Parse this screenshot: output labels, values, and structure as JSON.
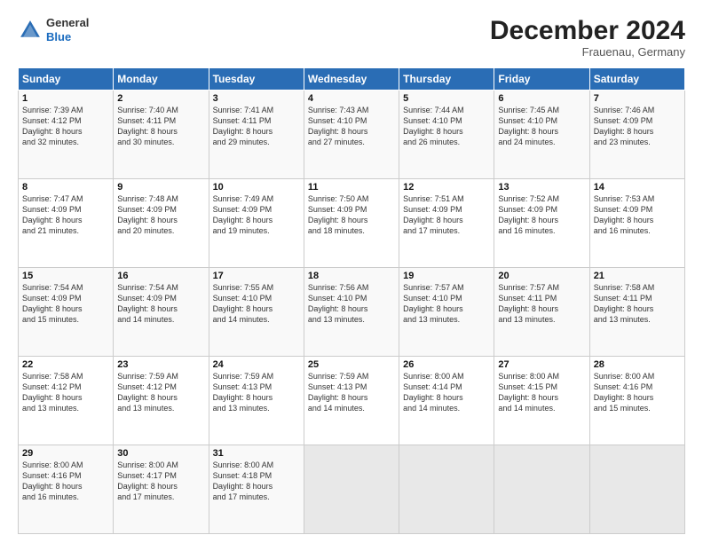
{
  "header": {
    "logo": {
      "general": "General",
      "blue": "Blue"
    },
    "month": "December 2024",
    "location": "Frauenau, Germany"
  },
  "weekdays": [
    "Sunday",
    "Monday",
    "Tuesday",
    "Wednesday",
    "Thursday",
    "Friday",
    "Saturday"
  ],
  "weeks": [
    [
      {
        "day": "1",
        "lines": [
          "Sunrise: 7:39 AM",
          "Sunset: 4:12 PM",
          "Daylight: 8 hours",
          "and 32 minutes."
        ]
      },
      {
        "day": "2",
        "lines": [
          "Sunrise: 7:40 AM",
          "Sunset: 4:11 PM",
          "Daylight: 8 hours",
          "and 30 minutes."
        ]
      },
      {
        "day": "3",
        "lines": [
          "Sunrise: 7:41 AM",
          "Sunset: 4:11 PM",
          "Daylight: 8 hours",
          "and 29 minutes."
        ]
      },
      {
        "day": "4",
        "lines": [
          "Sunrise: 7:43 AM",
          "Sunset: 4:10 PM",
          "Daylight: 8 hours",
          "and 27 minutes."
        ]
      },
      {
        "day": "5",
        "lines": [
          "Sunrise: 7:44 AM",
          "Sunset: 4:10 PM",
          "Daylight: 8 hours",
          "and 26 minutes."
        ]
      },
      {
        "day": "6",
        "lines": [
          "Sunrise: 7:45 AM",
          "Sunset: 4:10 PM",
          "Daylight: 8 hours",
          "and 24 minutes."
        ]
      },
      {
        "day": "7",
        "lines": [
          "Sunrise: 7:46 AM",
          "Sunset: 4:09 PM",
          "Daylight: 8 hours",
          "and 23 minutes."
        ]
      }
    ],
    [
      {
        "day": "8",
        "lines": [
          "Sunrise: 7:47 AM",
          "Sunset: 4:09 PM",
          "Daylight: 8 hours",
          "and 21 minutes."
        ]
      },
      {
        "day": "9",
        "lines": [
          "Sunrise: 7:48 AM",
          "Sunset: 4:09 PM",
          "Daylight: 8 hours",
          "and 20 minutes."
        ]
      },
      {
        "day": "10",
        "lines": [
          "Sunrise: 7:49 AM",
          "Sunset: 4:09 PM",
          "Daylight: 8 hours",
          "and 19 minutes."
        ]
      },
      {
        "day": "11",
        "lines": [
          "Sunrise: 7:50 AM",
          "Sunset: 4:09 PM",
          "Daylight: 8 hours",
          "and 18 minutes."
        ]
      },
      {
        "day": "12",
        "lines": [
          "Sunrise: 7:51 AM",
          "Sunset: 4:09 PM",
          "Daylight: 8 hours",
          "and 17 minutes."
        ]
      },
      {
        "day": "13",
        "lines": [
          "Sunrise: 7:52 AM",
          "Sunset: 4:09 PM",
          "Daylight: 8 hours",
          "and 16 minutes."
        ]
      },
      {
        "day": "14",
        "lines": [
          "Sunrise: 7:53 AM",
          "Sunset: 4:09 PM",
          "Daylight: 8 hours",
          "and 16 minutes."
        ]
      }
    ],
    [
      {
        "day": "15",
        "lines": [
          "Sunrise: 7:54 AM",
          "Sunset: 4:09 PM",
          "Daylight: 8 hours",
          "and 15 minutes."
        ]
      },
      {
        "day": "16",
        "lines": [
          "Sunrise: 7:54 AM",
          "Sunset: 4:09 PM",
          "Daylight: 8 hours",
          "and 14 minutes."
        ]
      },
      {
        "day": "17",
        "lines": [
          "Sunrise: 7:55 AM",
          "Sunset: 4:10 PM",
          "Daylight: 8 hours",
          "and 14 minutes."
        ]
      },
      {
        "day": "18",
        "lines": [
          "Sunrise: 7:56 AM",
          "Sunset: 4:10 PM",
          "Daylight: 8 hours",
          "and 13 minutes."
        ]
      },
      {
        "day": "19",
        "lines": [
          "Sunrise: 7:57 AM",
          "Sunset: 4:10 PM",
          "Daylight: 8 hours",
          "and 13 minutes."
        ]
      },
      {
        "day": "20",
        "lines": [
          "Sunrise: 7:57 AM",
          "Sunset: 4:11 PM",
          "Daylight: 8 hours",
          "and 13 minutes."
        ]
      },
      {
        "day": "21",
        "lines": [
          "Sunrise: 7:58 AM",
          "Sunset: 4:11 PM",
          "Daylight: 8 hours",
          "and 13 minutes."
        ]
      }
    ],
    [
      {
        "day": "22",
        "lines": [
          "Sunrise: 7:58 AM",
          "Sunset: 4:12 PM",
          "Daylight: 8 hours",
          "and 13 minutes."
        ]
      },
      {
        "day": "23",
        "lines": [
          "Sunrise: 7:59 AM",
          "Sunset: 4:12 PM",
          "Daylight: 8 hours",
          "and 13 minutes."
        ]
      },
      {
        "day": "24",
        "lines": [
          "Sunrise: 7:59 AM",
          "Sunset: 4:13 PM",
          "Daylight: 8 hours",
          "and 13 minutes."
        ]
      },
      {
        "day": "25",
        "lines": [
          "Sunrise: 7:59 AM",
          "Sunset: 4:13 PM",
          "Daylight: 8 hours",
          "and 14 minutes."
        ]
      },
      {
        "day": "26",
        "lines": [
          "Sunrise: 8:00 AM",
          "Sunset: 4:14 PM",
          "Daylight: 8 hours",
          "and 14 minutes."
        ]
      },
      {
        "day": "27",
        "lines": [
          "Sunrise: 8:00 AM",
          "Sunset: 4:15 PM",
          "Daylight: 8 hours",
          "and 14 minutes."
        ]
      },
      {
        "day": "28",
        "lines": [
          "Sunrise: 8:00 AM",
          "Sunset: 4:16 PM",
          "Daylight: 8 hours",
          "and 15 minutes."
        ]
      }
    ],
    [
      {
        "day": "29",
        "lines": [
          "Sunrise: 8:00 AM",
          "Sunset: 4:16 PM",
          "Daylight: 8 hours",
          "and 16 minutes."
        ]
      },
      {
        "day": "30",
        "lines": [
          "Sunrise: 8:00 AM",
          "Sunset: 4:17 PM",
          "Daylight: 8 hours",
          "and 17 minutes."
        ]
      },
      {
        "day": "31",
        "lines": [
          "Sunrise: 8:00 AM",
          "Sunset: 4:18 PM",
          "Daylight: 8 hours",
          "and 17 minutes."
        ]
      },
      {
        "day": "",
        "lines": []
      },
      {
        "day": "",
        "lines": []
      },
      {
        "day": "",
        "lines": []
      },
      {
        "day": "",
        "lines": []
      }
    ]
  ]
}
